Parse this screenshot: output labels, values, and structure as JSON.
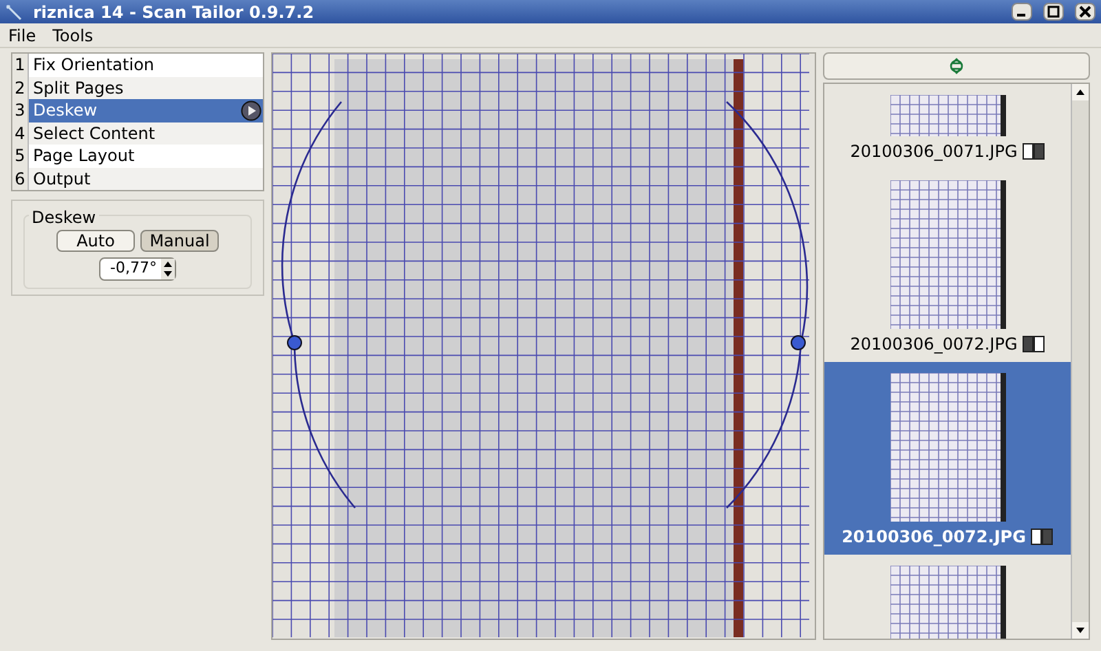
{
  "window": {
    "title": "riznica 14 - Scan Tailor 0.9.7.2"
  },
  "menu": [
    "File",
    "Tools"
  ],
  "steps": [
    {
      "number": "1",
      "label": "Fix Orientation",
      "selected": false
    },
    {
      "number": "2",
      "label": "Split Pages",
      "selected": false
    },
    {
      "number": "3",
      "label": "Deskew",
      "selected": true
    },
    {
      "number": "4",
      "label": "Select Content",
      "selected": false
    },
    {
      "number": "5",
      "label": "Page Layout",
      "selected": false
    },
    {
      "number": "6",
      "label": "Output",
      "selected": false
    }
  ],
  "deskew": {
    "title": "Deskew",
    "modes": [
      {
        "label": "Auto",
        "selected": false
      },
      {
        "label": "Manual",
        "selected": true
      }
    ],
    "angle": "-0,77°"
  },
  "thumbnails": [
    {
      "label": "20100306_0071.JPG",
      "kind": "right",
      "selected": false
    },
    {
      "label": "20100306_0072.JPG",
      "kind": "left",
      "selected": false
    },
    {
      "label": "20100306_0072.JPG",
      "kind": "right",
      "selected": true
    },
    {
      "selected": false
    }
  ]
}
